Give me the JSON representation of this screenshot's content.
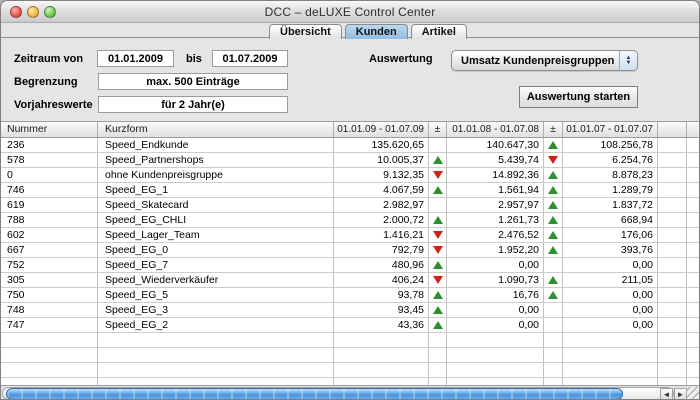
{
  "window": {
    "title": "DCC – deLUXE Control Center"
  },
  "tabs": [
    {
      "label": "Übersicht",
      "active": false
    },
    {
      "label": "Kunden",
      "active": true
    },
    {
      "label": "Artikel",
      "active": false
    }
  ],
  "form": {
    "zeitraum_label": "Zeitraum von",
    "zeitraum_von": "01.01.2009",
    "bis_label": "bis",
    "zeitraum_bis": "01.07.2009",
    "begrenzung_label": "Begrenzung",
    "begrenzung_value": "max. 500 Einträge",
    "vorjahreswerte_label": "Vorjahreswerte",
    "vorjahreswerte_value": "für 2 Jahr(e)",
    "auswertung_label": "Auswertung",
    "auswertung_value": "Umsatz Kundenpreisgruppen",
    "start_button_label": "Auswertung starten"
  },
  "icons": {
    "popup_stepper_up": "▲",
    "popup_stepper_down": "▼",
    "scroll_left": "◄",
    "scroll_right": "►"
  },
  "colors": {
    "trend_up": "#2d8f2d",
    "trend_down": "#cf2318",
    "tab_active": "#92bce2",
    "scrollbar_thumb": "#4b94dd"
  },
  "table": {
    "columns": {
      "nummer": "Nummer",
      "kurzform": "Kurzform",
      "period1": "01.01.09 - 01.07.09",
      "pm1": "±",
      "period2": "01.01.08 - 01.07.08",
      "pm2": "±",
      "period3": "01.01.07 - 01.07.07"
    },
    "rows": [
      {
        "num": "236",
        "name": "Speed_Endkunde",
        "v1": "135.620,65",
        "a1": "",
        "v2": "140.647,30",
        "a2": "up",
        "v3": "108.256,78"
      },
      {
        "num": "578",
        "name": "Speed_Partnershops",
        "v1": "10.005,37",
        "a1": "up",
        "v2": "5.439,74",
        "a2": "down",
        "v3": "6.254,76"
      },
      {
        "num": "0",
        "name": "ohne Kundenpreisgruppe",
        "v1": "9.132,35",
        "a1": "down",
        "v2": "14.892,36",
        "a2": "up",
        "v3": "8.878,23"
      },
      {
        "num": "746",
        "name": "Speed_EG_1",
        "v1": "4.067,59",
        "a1": "up",
        "v2": "1.561,94",
        "a2": "up",
        "v3": "1.289,79"
      },
      {
        "num": "619",
        "name": "Speed_Skatecard",
        "v1": "2.982,97",
        "a1": "",
        "v2": "2.957,97",
        "a2": "up",
        "v3": "1.837,72"
      },
      {
        "num": "788",
        "name": "Speed_EG_CHLI",
        "v1": "2.000,72",
        "a1": "up",
        "v2": "1.261,73",
        "a2": "up",
        "v3": "668,94"
      },
      {
        "num": "602",
        "name": "Speed_Lager_Team",
        "v1": "1.416,21",
        "a1": "down",
        "v2": "2.476,52",
        "a2": "up",
        "v3": "176,06"
      },
      {
        "num": "667",
        "name": "Speed_EG_0",
        "v1": "792,79",
        "a1": "down",
        "v2": "1.952,20",
        "a2": "up",
        "v3": "393,76"
      },
      {
        "num": "752",
        "name": "Speed_EG_7",
        "v1": "480,96",
        "a1": "up",
        "v2": "0,00",
        "a2": "",
        "v3": "0,00"
      },
      {
        "num": "305",
        "name": "Speed_Wiederverkäufer",
        "v1": "406,24",
        "a1": "down",
        "v2": "1.090,73",
        "a2": "up",
        "v3": "211,05"
      },
      {
        "num": "750",
        "name": "Speed_EG_5",
        "v1": "93,78",
        "a1": "up",
        "v2": "16,76",
        "a2": "up",
        "v3": "0,00"
      },
      {
        "num": "748",
        "name": "Speed_EG_3",
        "v1": "93,45",
        "a1": "up",
        "v2": "0,00",
        "a2": "",
        "v3": "0,00"
      },
      {
        "num": "747",
        "name": "Speed_EG_2",
        "v1": "43,36",
        "a1": "up",
        "v2": "0,00",
        "a2": "",
        "v3": "0,00"
      }
    ]
  }
}
